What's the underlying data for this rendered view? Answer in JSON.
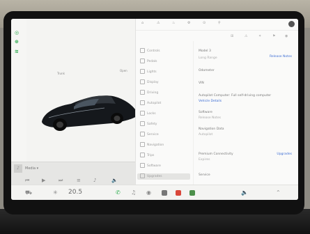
{
  "status": {
    "icons": [
      "steering-icon",
      "lock-icon",
      "signal-icon"
    ]
  },
  "car": {
    "label_left": "Trunk",
    "label_right": "Open",
    "color": "#15181c"
  },
  "media": {
    "title": "Media ▾",
    "controls": [
      "⏮",
      "▶",
      "⏭",
      "≡",
      "♪",
      "🔈"
    ]
  },
  "topbar": {
    "items": [
      "⌂",
      "⚠",
      "♨",
      "⚙",
      "⊙",
      "⚲"
    ]
  },
  "subbar": {
    "items": [
      "⊞",
      "⚠",
      "✶",
      "⚑",
      "◉"
    ]
  },
  "menu": {
    "items": [
      "Controls",
      "Pedals",
      "Lights",
      "Display",
      "Driving",
      "Autopilot",
      "Locks",
      "Safety",
      "Service",
      "Navigation",
      "Trips",
      "Software",
      "Upgrades"
    ],
    "active_index": 12
  },
  "content": {
    "lines": [
      "Model 3",
      "Long Range",
      "Odometer",
      "VIN",
      "Autopilot Computer: Full self-driving computer",
      "Vehicle Details",
      "Software",
      "Release Notes",
      "Navigation Data",
      "Autopilot",
      "Premium Connectivity",
      "Expires",
      "Service"
    ],
    "link_right_1": "Release Notes",
    "link_right_2": "Upgrades"
  },
  "taskbar": {
    "temperature": "20.5",
    "icons": [
      "car-icon",
      "fan-icon",
      "phone-icon",
      "music-icon",
      "camera-icon",
      "calendar-icon",
      "dots-icon",
      "app-icon",
      "volume-icon"
    ]
  },
  "colors": {
    "accent": "#3e6ed4",
    "status_green": "#2aa84a",
    "screen": "#f1f1ef"
  }
}
